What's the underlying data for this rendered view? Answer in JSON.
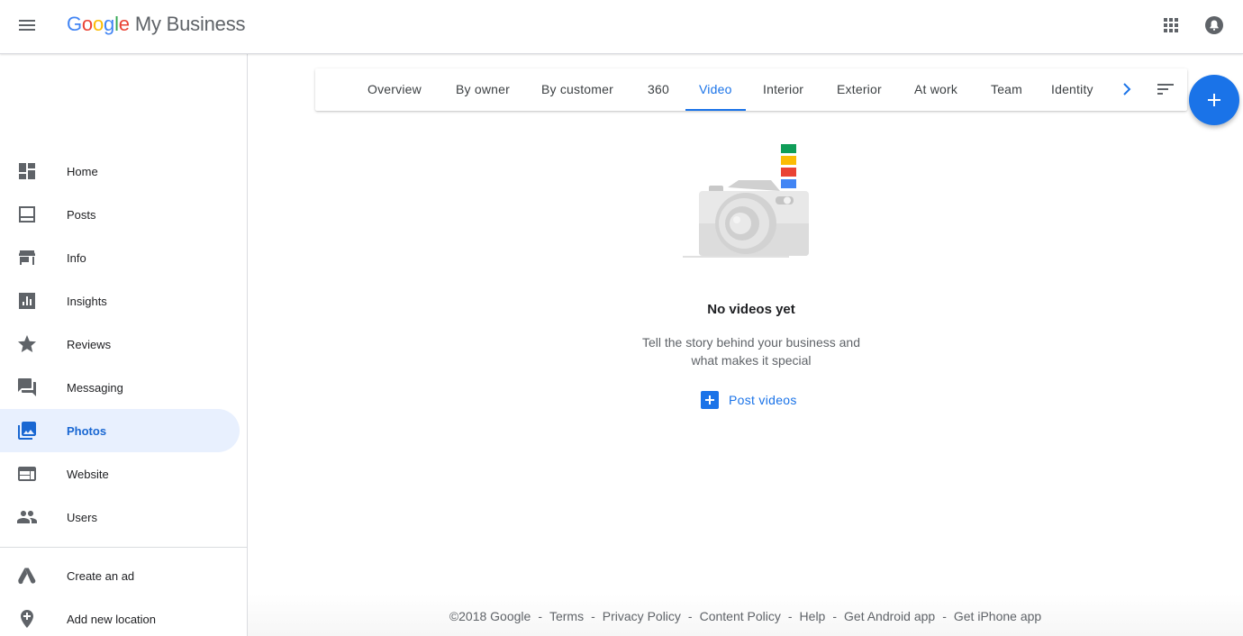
{
  "header": {
    "logo_letters": [
      "G",
      "o",
      "o",
      "g",
      "l",
      "e"
    ],
    "product_name": "My Business"
  },
  "sidebar": {
    "items": [
      {
        "label": "Home",
        "icon": "dashboard-icon"
      },
      {
        "label": "Posts",
        "icon": "posts-icon"
      },
      {
        "label": "Info",
        "icon": "store-icon"
      },
      {
        "label": "Insights",
        "icon": "insights-icon"
      },
      {
        "label": "Reviews",
        "icon": "star-icon"
      },
      {
        "label": "Messaging",
        "icon": "messaging-icon"
      },
      {
        "label": "Photos",
        "icon": "photos-icon",
        "active": true
      },
      {
        "label": "Website",
        "icon": "website-icon"
      },
      {
        "label": "Users",
        "icon": "users-icon"
      }
    ],
    "secondary_items": [
      {
        "label": "Create an ad",
        "icon": "google-ads-icon"
      },
      {
        "label": "Add new location",
        "icon": "add-location-icon"
      }
    ]
  },
  "tabs": {
    "items": [
      "Overview",
      "By owner",
      "By customer",
      "360",
      "Video",
      "Interior",
      "Exterior",
      "At work",
      "Team",
      "Identity"
    ],
    "active": "Video"
  },
  "empty_state": {
    "title": "No videos yet",
    "description_line1": "Tell the story behind your business and",
    "description_line2": "what makes it special",
    "action_label": "Post videos"
  },
  "footer": {
    "links": [
      "©2018 Google",
      "Terms",
      "Privacy Policy",
      "Content Policy",
      "Help",
      "Get Android app",
      "Get iPhone app"
    ],
    "separator": "-"
  },
  "colors": {
    "accent": "#1a73e8",
    "active_nav_bg": "#e8f0fe",
    "illustration_stripes": [
      "#0f9d58",
      "#fbbc05",
      "#ea4335",
      "#4285f4"
    ]
  }
}
